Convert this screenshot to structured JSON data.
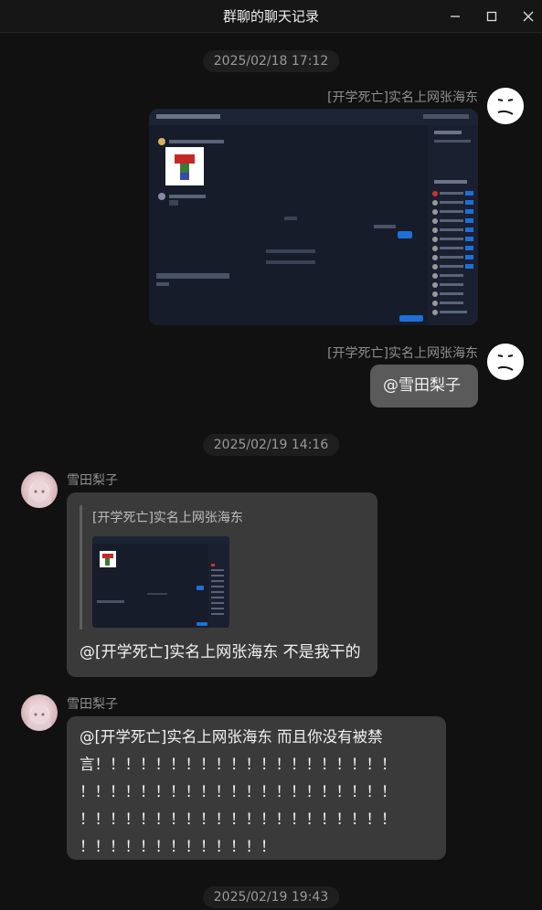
{
  "window": {
    "title": "群聊的聊天记录",
    "controls": [
      "minimize-icon",
      "maximize-icon",
      "close-icon"
    ]
  },
  "messages": [
    {
      "timestamp": "2025/02/18 17:12",
      "items": [
        {
          "side": "right",
          "sender": "[开学死亡]实名上网张海东",
          "type": "image",
          "image_desc_icon": "screenshot-thumbnail"
        },
        {
          "side": "right",
          "sender": "[开学死亡]实名上网张海东",
          "type": "text",
          "text": "@雪田梨子"
        }
      ]
    },
    {
      "timestamp": "2025/02/19 14:16",
      "items": [
        {
          "side": "left",
          "sender": "雪田梨子",
          "type": "reply",
          "quote_sender": "[开学死亡]实名上网张海东",
          "text": "@[开学死亡]实名上网张海东 不是我干的"
        },
        {
          "side": "left",
          "sender": "雪田梨子",
          "type": "text",
          "lines": [
            "@[开学死亡]实名上网张海东 而且你没有被禁",
            "言！！！！！！！！！！！！！！！！！！！！",
            "！！！！！！！！！！！！！！！！！！！！！",
            "！！！！！！！！！！！！！！！！！！！！！",
            "！！！！！！！！！！！！！"
          ]
        }
      ]
    },
    {
      "timestamp": "2025/02/19 19:43",
      "items": []
    }
  ],
  "colors": {
    "background": "#111111",
    "bubble_other": "#3a3a3a",
    "bubble_me": "#5a5a5a",
    "muted": "#8f8f8f"
  }
}
